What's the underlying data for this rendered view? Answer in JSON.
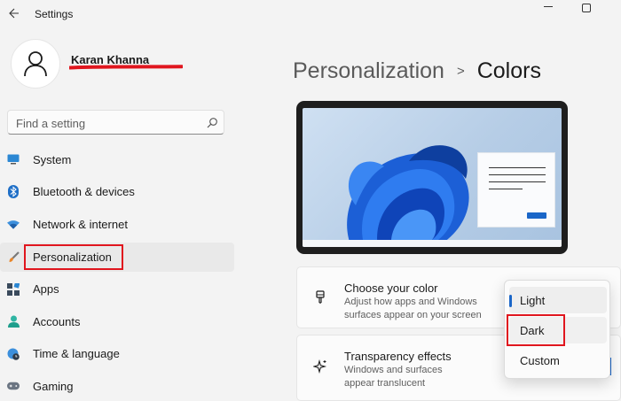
{
  "titlebar": {
    "title": "Settings"
  },
  "user": {
    "name": "Karan Khanna"
  },
  "search": {
    "placeholder": "Find a setting"
  },
  "sidebar": {
    "items": [
      {
        "label": "System",
        "icon": "monitor-icon"
      },
      {
        "label": "Bluetooth & devices",
        "icon": "bluetooth-icon"
      },
      {
        "label": "Network & internet",
        "icon": "wifi-icon"
      },
      {
        "label": "Personalization",
        "icon": "brush-icon",
        "selected": true
      },
      {
        "label": "Apps",
        "icon": "apps-icon"
      },
      {
        "label": "Accounts",
        "icon": "person-icon"
      },
      {
        "label": "Time & language",
        "icon": "globe-clock-icon"
      },
      {
        "label": "Gaming",
        "icon": "gamepad-icon"
      }
    ]
  },
  "breadcrumb": {
    "parent": "Personalization",
    "separator": ">",
    "current": "Colors"
  },
  "cards": {
    "choose_color": {
      "title": "Choose your color",
      "desc_line1": "Adjust how apps and Windows",
      "desc_line2": "surfaces appear on your screen",
      "icon": "palette-brush-icon"
    },
    "transparency": {
      "title": "Transparency effects",
      "desc_line1": "Windows and surfaces",
      "desc_line2": "appear translucent",
      "icon": "sparkle-icon"
    }
  },
  "dropdown": {
    "options": [
      "Light",
      "Dark",
      "Custom"
    ],
    "current": "Light",
    "highlighted": "Dark"
  },
  "colors": {
    "accent": "#1a66c8",
    "highlight_annotation": "#e0161e",
    "sidebar_selected_bg": "#e9e9e9",
    "window_bg": "#f3f3f3"
  }
}
